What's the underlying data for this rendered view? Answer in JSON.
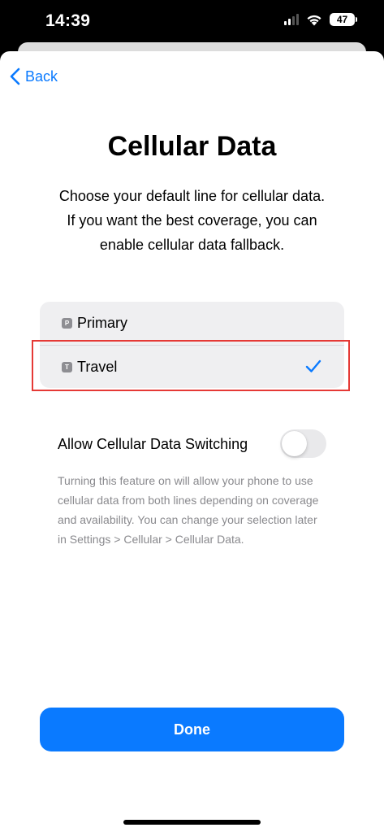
{
  "status_bar": {
    "time": "14:39",
    "battery": "47",
    "icons": [
      "cellular-signal-icon",
      "wifi-icon",
      "battery-icon"
    ]
  },
  "nav": {
    "back_label": "Back"
  },
  "header": {
    "title": "Cellular Data",
    "subtitle": "Choose your default line for cellular data. If you want the best coverage, you can enable cellular data fallback."
  },
  "lines": [
    {
      "badge": "P",
      "label": "Primary",
      "selected": false
    },
    {
      "badge": "T",
      "label": "Travel",
      "selected": true
    }
  ],
  "data_switching": {
    "label": "Allow Cellular Data Switching",
    "enabled": false,
    "description": "Turning this feature on will allow your phone to use cellular data from both lines depending on coverage and availability. You can change your selection later in Settings > Cellular > Cellular Data."
  },
  "actions": {
    "done_label": "Done"
  },
  "colors": {
    "accent": "#0a7aff",
    "list_background": "#efeff1",
    "highlight": "#e53935"
  }
}
